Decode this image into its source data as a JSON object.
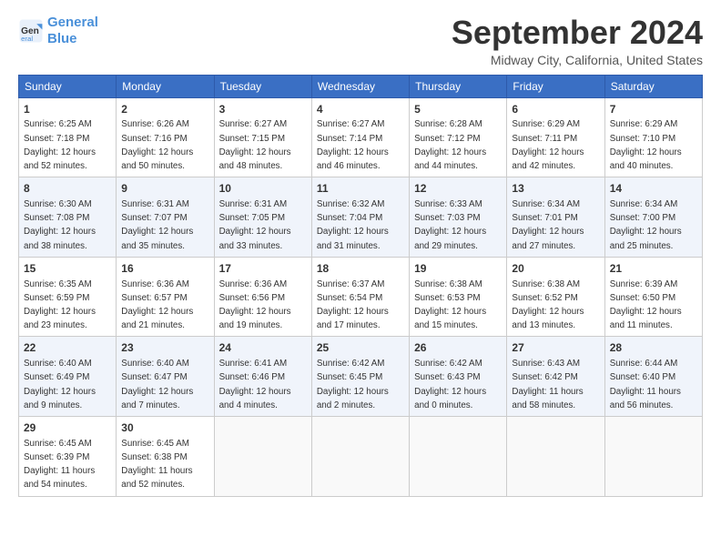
{
  "logo": {
    "line1": "General",
    "line2": "Blue"
  },
  "title": "September 2024",
  "location": "Midway City, California, United States",
  "headers": [
    "Sunday",
    "Monday",
    "Tuesday",
    "Wednesday",
    "Thursday",
    "Friday",
    "Saturday"
  ],
  "weeks": [
    [
      {
        "day": "1",
        "sunrise": "6:25 AM",
        "sunset": "7:18 PM",
        "daylight": "12 hours and 52 minutes."
      },
      {
        "day": "2",
        "sunrise": "6:26 AM",
        "sunset": "7:16 PM",
        "daylight": "12 hours and 50 minutes."
      },
      {
        "day": "3",
        "sunrise": "6:27 AM",
        "sunset": "7:15 PM",
        "daylight": "12 hours and 48 minutes."
      },
      {
        "day": "4",
        "sunrise": "6:27 AM",
        "sunset": "7:14 PM",
        "daylight": "12 hours and 46 minutes."
      },
      {
        "day": "5",
        "sunrise": "6:28 AM",
        "sunset": "7:12 PM",
        "daylight": "12 hours and 44 minutes."
      },
      {
        "day": "6",
        "sunrise": "6:29 AM",
        "sunset": "7:11 PM",
        "daylight": "12 hours and 42 minutes."
      },
      {
        "day": "7",
        "sunrise": "6:29 AM",
        "sunset": "7:10 PM",
        "daylight": "12 hours and 40 minutes."
      }
    ],
    [
      {
        "day": "8",
        "sunrise": "6:30 AM",
        "sunset": "7:08 PM",
        "daylight": "12 hours and 38 minutes."
      },
      {
        "day": "9",
        "sunrise": "6:31 AM",
        "sunset": "7:07 PM",
        "daylight": "12 hours and 35 minutes."
      },
      {
        "day": "10",
        "sunrise": "6:31 AM",
        "sunset": "7:05 PM",
        "daylight": "12 hours and 33 minutes."
      },
      {
        "day": "11",
        "sunrise": "6:32 AM",
        "sunset": "7:04 PM",
        "daylight": "12 hours and 31 minutes."
      },
      {
        "day": "12",
        "sunrise": "6:33 AM",
        "sunset": "7:03 PM",
        "daylight": "12 hours and 29 minutes."
      },
      {
        "day": "13",
        "sunrise": "6:34 AM",
        "sunset": "7:01 PM",
        "daylight": "12 hours and 27 minutes."
      },
      {
        "day": "14",
        "sunrise": "6:34 AM",
        "sunset": "7:00 PM",
        "daylight": "12 hours and 25 minutes."
      }
    ],
    [
      {
        "day": "15",
        "sunrise": "6:35 AM",
        "sunset": "6:59 PM",
        "daylight": "12 hours and 23 minutes."
      },
      {
        "day": "16",
        "sunrise": "6:36 AM",
        "sunset": "6:57 PM",
        "daylight": "12 hours and 21 minutes."
      },
      {
        "day": "17",
        "sunrise": "6:36 AM",
        "sunset": "6:56 PM",
        "daylight": "12 hours and 19 minutes."
      },
      {
        "day": "18",
        "sunrise": "6:37 AM",
        "sunset": "6:54 PM",
        "daylight": "12 hours and 17 minutes."
      },
      {
        "day": "19",
        "sunrise": "6:38 AM",
        "sunset": "6:53 PM",
        "daylight": "12 hours and 15 minutes."
      },
      {
        "day": "20",
        "sunrise": "6:38 AM",
        "sunset": "6:52 PM",
        "daylight": "12 hours and 13 minutes."
      },
      {
        "day": "21",
        "sunrise": "6:39 AM",
        "sunset": "6:50 PM",
        "daylight": "12 hours and 11 minutes."
      }
    ],
    [
      {
        "day": "22",
        "sunrise": "6:40 AM",
        "sunset": "6:49 PM",
        "daylight": "12 hours and 9 minutes."
      },
      {
        "day": "23",
        "sunrise": "6:40 AM",
        "sunset": "6:47 PM",
        "daylight": "12 hours and 7 minutes."
      },
      {
        "day": "24",
        "sunrise": "6:41 AM",
        "sunset": "6:46 PM",
        "daylight": "12 hours and 4 minutes."
      },
      {
        "day": "25",
        "sunrise": "6:42 AM",
        "sunset": "6:45 PM",
        "daylight": "12 hours and 2 minutes."
      },
      {
        "day": "26",
        "sunrise": "6:42 AM",
        "sunset": "6:43 PM",
        "daylight": "12 hours and 0 minutes."
      },
      {
        "day": "27",
        "sunrise": "6:43 AM",
        "sunset": "6:42 PM",
        "daylight": "11 hours and 58 minutes."
      },
      {
        "day": "28",
        "sunrise": "6:44 AM",
        "sunset": "6:40 PM",
        "daylight": "11 hours and 56 minutes."
      }
    ],
    [
      {
        "day": "29",
        "sunrise": "6:45 AM",
        "sunset": "6:39 PM",
        "daylight": "11 hours and 54 minutes."
      },
      {
        "day": "30",
        "sunrise": "6:45 AM",
        "sunset": "6:38 PM",
        "daylight": "11 hours and 52 minutes."
      },
      null,
      null,
      null,
      null,
      null
    ]
  ]
}
